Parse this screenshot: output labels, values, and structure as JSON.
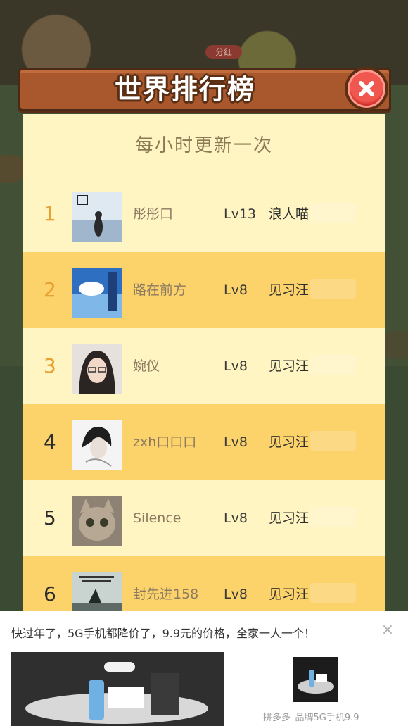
{
  "modal": {
    "title": "世界排行榜",
    "subtitle": "每小时更新一次",
    "close_icon": "close-icon"
  },
  "ranking": [
    {
      "rank": "1",
      "name": "彤彤口",
      "level": "Lv13",
      "title": "浪人喵"
    },
    {
      "rank": "2",
      "name": "路在前方",
      "level": "Lv8",
      "title": "见习汪"
    },
    {
      "rank": "3",
      "name": "婉仪",
      "level": "Lv8",
      "title": "见习汪"
    },
    {
      "rank": "4",
      "name": "zxh口口口",
      "level": "Lv8",
      "title": "见习汪"
    },
    {
      "rank": "5",
      "name": "Silence",
      "level": "Lv8",
      "title": "见习汪"
    },
    {
      "rank": "6",
      "name": "封先进158",
      "level": "Lv8",
      "title": "见习汪"
    }
  ],
  "background": {
    "pill_label": "分红"
  },
  "ad": {
    "text": "快过年了，5G手机都降价了，9.9元的价格，全家一人一个！",
    "caption": "拼多多–品牌5G手机9.9",
    "close_label": "×"
  },
  "colors": {
    "header": "#a9582e",
    "panel": "#fff5c2",
    "highlight_row": "#fcd26b",
    "top_rank": "#e8a030"
  }
}
